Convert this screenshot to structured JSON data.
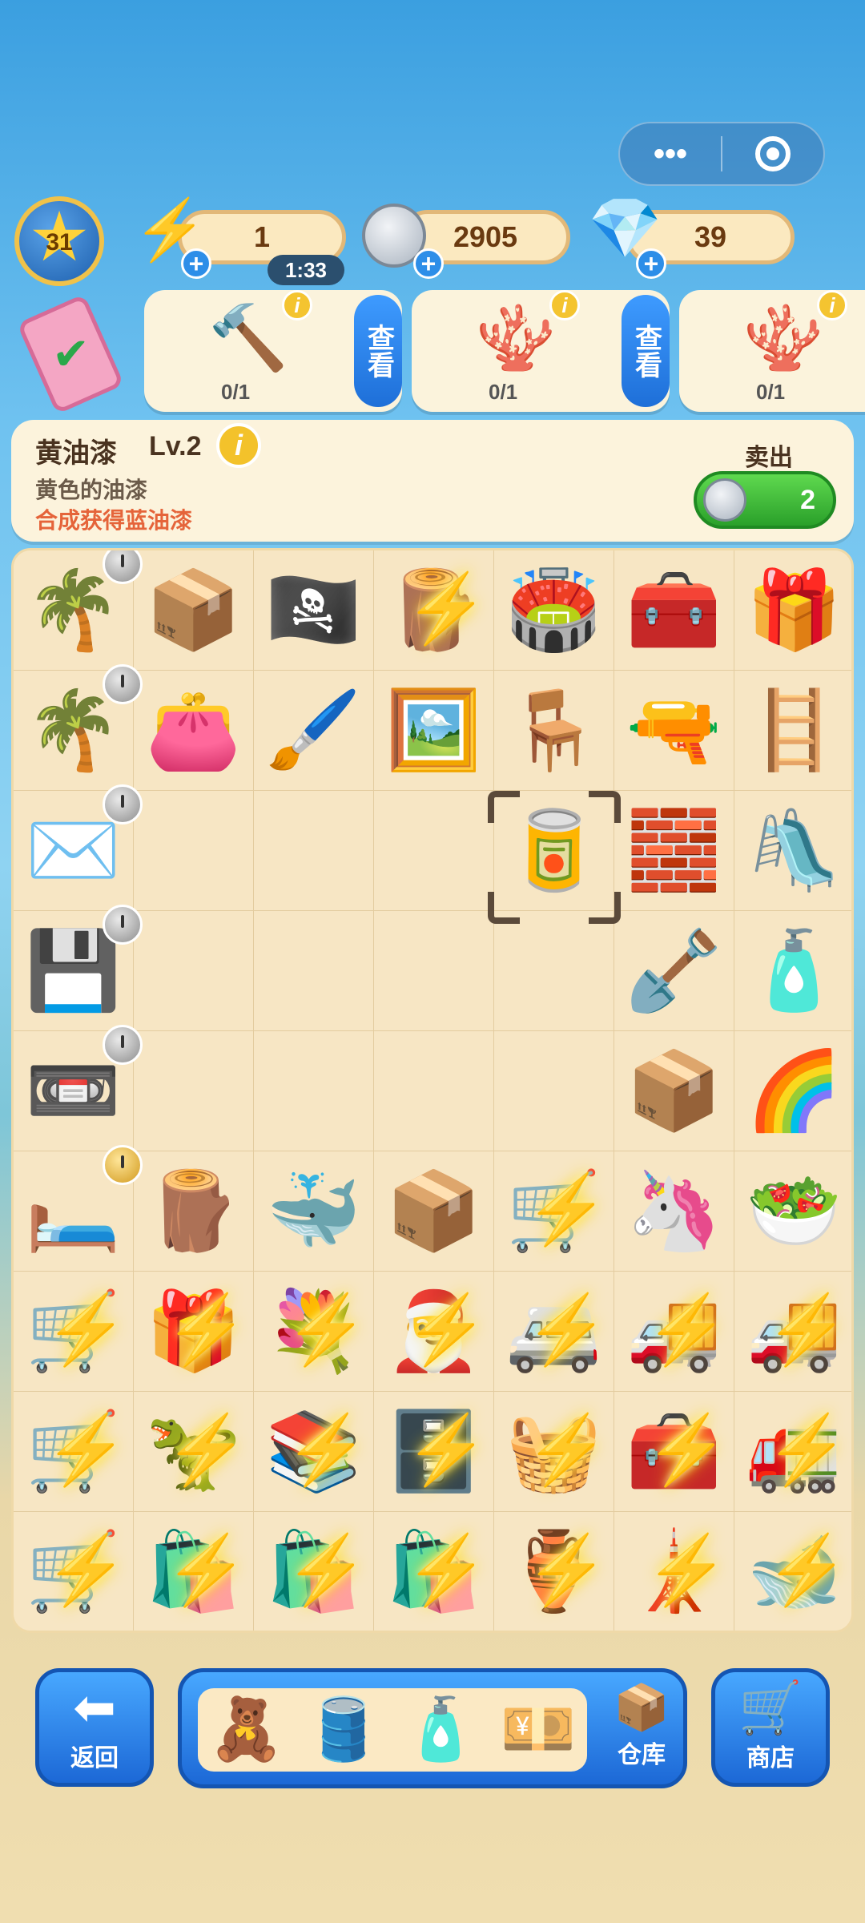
{
  "level": "31",
  "energy": {
    "value": "1",
    "timer": "1:33"
  },
  "coins": {
    "value": "2905"
  },
  "gems": {
    "value": "39"
  },
  "orders": [
    {
      "icon": "🔨",
      "count": "0/1",
      "view_label": "查看"
    },
    {
      "icon": "🪸",
      "count": "0/1",
      "view_label": "查看"
    },
    {
      "icon": "🪸",
      "count": "0/1"
    }
  ],
  "detail": {
    "name": "黄油漆",
    "level": "Lv.2",
    "description": "黄色的油漆",
    "hint": "合成获得蓝油漆",
    "sell_label": "卖出",
    "sell_price": "2"
  },
  "board": {
    "rows": [
      [
        {
          "g": "🌴",
          "clock": true
        },
        {
          "g": "📦"
        },
        {
          "g": "🏴‍☠️"
        },
        {
          "g": "🪵",
          "bolt": true
        },
        {
          "g": "🏟️"
        },
        {
          "g": "🧰"
        },
        {
          "g": "🎁"
        }
      ],
      [
        {
          "g": "🌴",
          "clock": true
        },
        {
          "g": "👛"
        },
        {
          "g": "🖌️"
        },
        {
          "g": "🖼️"
        },
        {
          "g": "🪑"
        },
        {
          "g": "🔫"
        },
        {
          "g": "🪜"
        }
      ],
      [
        {
          "g": "✉️",
          "clock": true
        },
        {
          "g": ""
        },
        {
          "g": ""
        },
        {
          "g": ""
        },
        {
          "g": "🥫"
        },
        {
          "g": "🧱"
        },
        {
          "g": "🛝"
        }
      ],
      [
        {
          "g": "💾",
          "clock": true
        },
        {
          "g": ""
        },
        {
          "g": ""
        },
        {
          "g": ""
        },
        {
          "g": ""
        },
        {
          "g": "🪏"
        },
        {
          "g": "🧴"
        }
      ],
      [
        {
          "g": "📼",
          "clock": true
        },
        {
          "g": ""
        },
        {
          "g": ""
        },
        {
          "g": ""
        },
        {
          "g": ""
        },
        {
          "g": "📦"
        },
        {
          "g": "🌈"
        }
      ],
      [
        {
          "g": "🛏️",
          "clock": true,
          "gold": true
        },
        {
          "g": "🪵"
        },
        {
          "g": "🐳"
        },
        {
          "g": "📦"
        },
        {
          "g": "🛒",
          "bolt": true
        },
        {
          "g": "🦄"
        },
        {
          "g": "🥗"
        }
      ],
      [
        {
          "g": "🛒",
          "bolt": true
        },
        {
          "g": "🎁",
          "bolt": true
        },
        {
          "g": "💐",
          "bolt": true
        },
        {
          "g": "🎅",
          "bolt": true
        },
        {
          "g": "🚐",
          "bolt": true
        },
        {
          "g": "🚚",
          "bolt": true
        },
        {
          "g": "🚚",
          "bolt": true
        }
      ],
      [
        {
          "g": "🛒",
          "bolt": true
        },
        {
          "g": "🦖",
          "bolt": true
        },
        {
          "g": "📚",
          "bolt": true
        },
        {
          "g": "🗄️",
          "bolt": true
        },
        {
          "g": "🧺",
          "bolt": true
        },
        {
          "g": "🧰",
          "bolt": true
        },
        {
          "g": "🚛",
          "bolt": true
        }
      ],
      [
        {
          "g": "🛒",
          "bolt": true
        },
        {
          "g": "🛍️",
          "bolt": true
        },
        {
          "g": "🛍️",
          "bolt": true
        },
        {
          "g": "🛍️",
          "bolt": true
        },
        {
          "g": "🏺",
          "bolt": true
        },
        {
          "g": "🗼",
          "bolt": true
        },
        {
          "g": "🐋",
          "bolt": true
        }
      ]
    ]
  },
  "bottom": {
    "back_label": "返回",
    "storage_label": "仓库",
    "shop_label": "商店",
    "inventory_items": [
      "🧸",
      "🛢️",
      "🧴",
      "💴"
    ]
  },
  "colors": {
    "accent_blue": "#1c68d6",
    "sell_green": "#2aa02a",
    "hint_orange": "#e5643a"
  }
}
